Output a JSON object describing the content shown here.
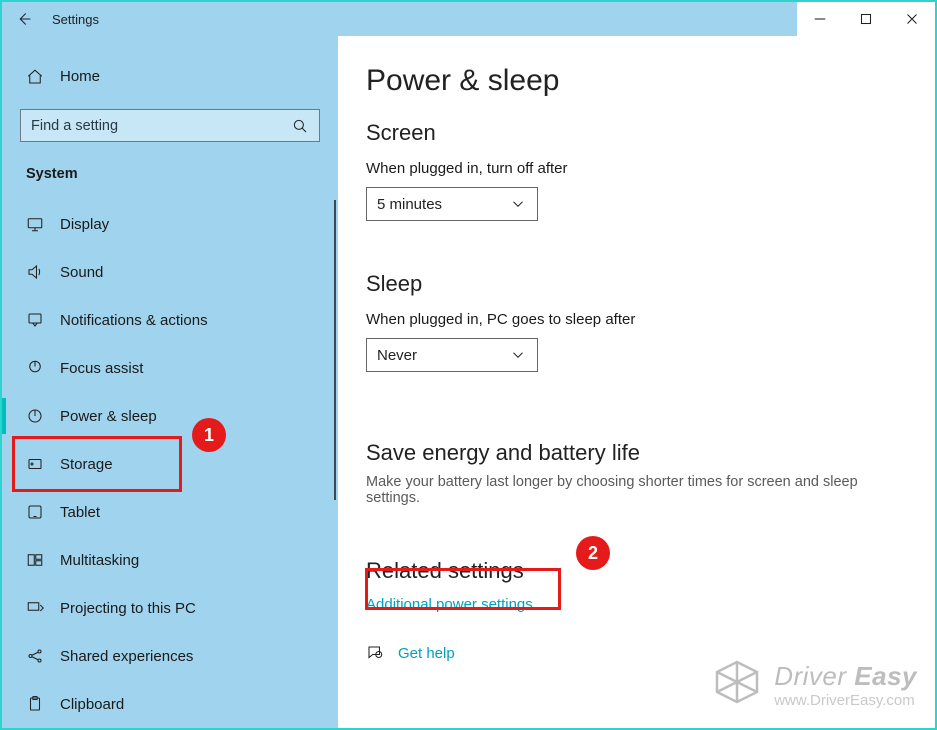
{
  "window": {
    "title": "Settings"
  },
  "sidebar": {
    "home_label": "Home",
    "search_placeholder": "Find a setting",
    "category_header": "System",
    "items": [
      {
        "icon": "display-icon",
        "label": "Display"
      },
      {
        "icon": "sound-icon",
        "label": "Sound"
      },
      {
        "icon": "notifications-icon",
        "label": "Notifications & actions"
      },
      {
        "icon": "focus-assist-icon",
        "label": "Focus assist"
      },
      {
        "icon": "power-sleep-icon",
        "label": "Power & sleep",
        "active": true
      },
      {
        "icon": "storage-icon",
        "label": "Storage"
      },
      {
        "icon": "tablet-icon",
        "label": "Tablet"
      },
      {
        "icon": "multitasking-icon",
        "label": "Multitasking"
      },
      {
        "icon": "projecting-icon",
        "label": "Projecting to this PC"
      },
      {
        "icon": "shared-exp-icon",
        "label": "Shared experiences"
      },
      {
        "icon": "clipboard-icon",
        "label": "Clipboard"
      }
    ]
  },
  "page": {
    "title": "Power & sleep",
    "screen": {
      "heading": "Screen",
      "label": "When plugged in, turn off after",
      "value": "5 minutes"
    },
    "sleep": {
      "heading": "Sleep",
      "label": "When plugged in, PC goes to sleep after",
      "value": "Never"
    },
    "save_energy": {
      "heading": "Save energy and battery life",
      "text": "Make your battery last longer by choosing shorter times for screen and sleep settings."
    },
    "related": {
      "heading": "Related settings",
      "link": "Additional power settings"
    },
    "help": {
      "label": "Get help"
    }
  },
  "annotations": {
    "bubble1": "1",
    "bubble2": "2"
  },
  "watermark": {
    "brand_part1": "Driver",
    "brand_part2": "Easy",
    "url": "www.DriverEasy.com"
  }
}
